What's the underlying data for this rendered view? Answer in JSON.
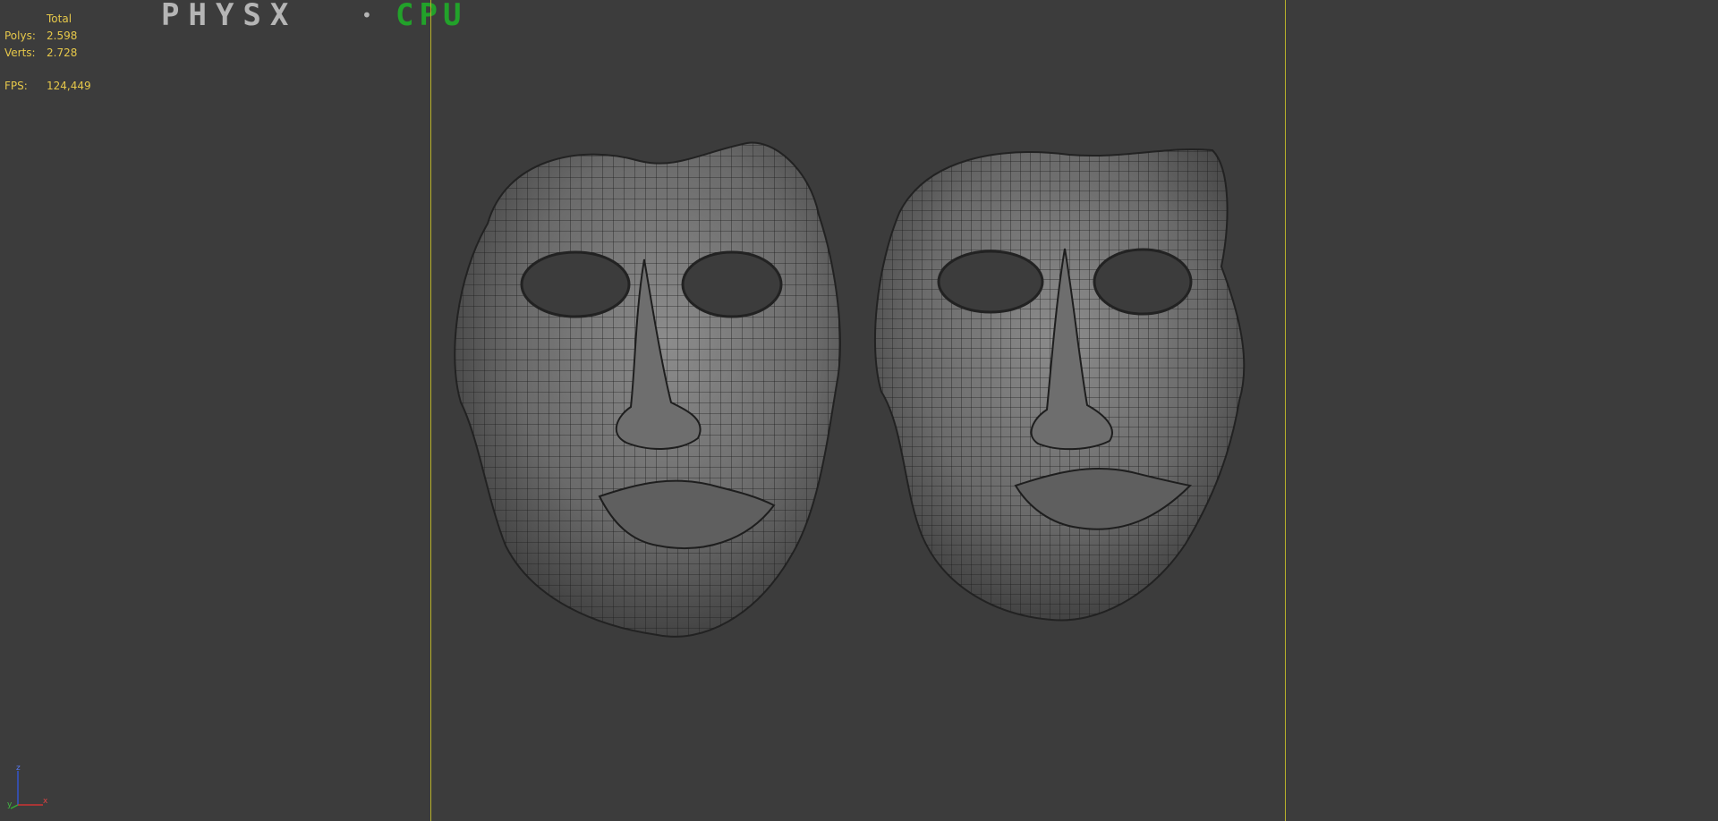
{
  "stats": {
    "header": "Total",
    "polys_label": "Polys:",
    "polys_value": "2.598",
    "verts_label": "Verts:",
    "verts_value": "2.728",
    "fps_label": "FPS:",
    "fps_value": "124,449"
  },
  "logo": {
    "physx": "PHYSX",
    "separator": "•",
    "mode": "CPU",
    "physx_color": "#b5b5b5",
    "x_color": "#2f9e2f",
    "mode_color": "#22a22a"
  },
  "axis": {
    "z": "z",
    "y": "y",
    "x": "x"
  },
  "colors": {
    "background": "#3c3c3c",
    "stats_text": "#e6c84a",
    "safe_frame": "#b8b12a"
  },
  "models": [
    {
      "name": "mask-left"
    },
    {
      "name": "mask-right"
    }
  ]
}
